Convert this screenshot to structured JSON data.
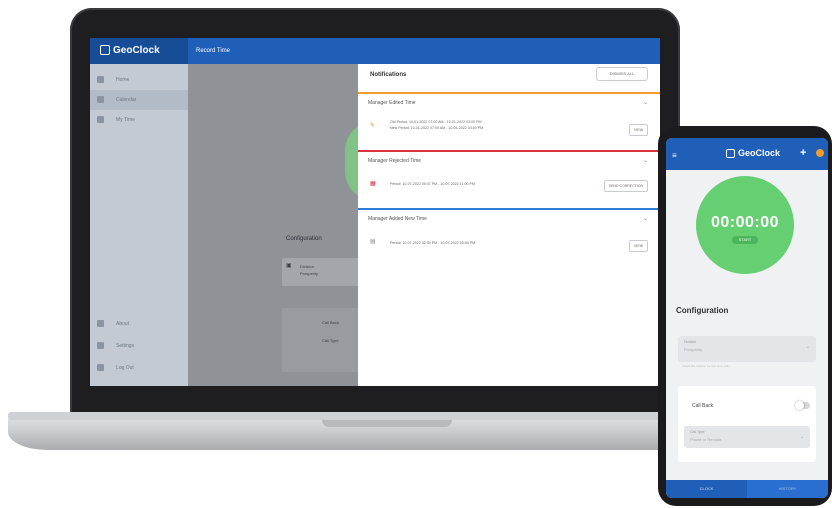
{
  "colors": {
    "brand_blue": "#1f5fb8",
    "timer_green": "#66cf72",
    "bar_orange": "#f29b2e",
    "bar_red": "#d9333f",
    "bar_blue": "#2f7bd6"
  },
  "laptop": {
    "logo_text": "GeoClock",
    "page_title": "Record Time",
    "sidebar": {
      "items": [
        {
          "label": "Home",
          "icon": "home-icon"
        },
        {
          "label": "Calendar",
          "icon": "calendar-icon"
        },
        {
          "label": "My Time",
          "icon": "clock-icon"
        },
        {
          "label": "About",
          "icon": "info-icon"
        },
        {
          "label": "Settings",
          "icon": "gear-icon"
        },
        {
          "label": "Log Out",
          "icon": "logout-icon"
        }
      ]
    },
    "main": {
      "configuration_title": "Configuration",
      "field_label": "Division",
      "field_value": "Prosperity",
      "callback_label": "Call Back",
      "call_type_label": "Call Type"
    },
    "notifications": {
      "title": "Notifications",
      "dismiss_all": "DISMISS ALL",
      "groups": [
        {
          "title": "Manager Edited Time",
          "line1": "Old Period: 10-01-2022 07:00 AM - 10-01-2022 03:00 PM",
          "line2": "New Period: 10-01-2022 07:00 AM - 10-01-2022 04:00 PM",
          "button": "VIEW"
        },
        {
          "title": "Manager Rejected Time",
          "line1": "Period: 10-07-2022 05:47 PM - 10-07-2022 11:00 PM",
          "button": "SEND CORRECTION"
        },
        {
          "title": "Manager Added New Time",
          "line1": "Period: 10-07-2022 02:30 PM - 10-07-2022 05:00 PM",
          "button": "VIEW"
        }
      ]
    }
  },
  "phone": {
    "logo_text": "GeoClock",
    "timer": "00:00:00",
    "start_label": "START",
    "configuration_title": "Configuration",
    "field_label": "Division",
    "field_value": "Prosperity",
    "helper_text": "Select the division for this time entry",
    "callback_label": "Call Back",
    "call_type_label": "Call Type",
    "call_type_value": "Phone or Remote",
    "bottom_left": "CLOCK",
    "bottom_right": "HISTORY"
  }
}
